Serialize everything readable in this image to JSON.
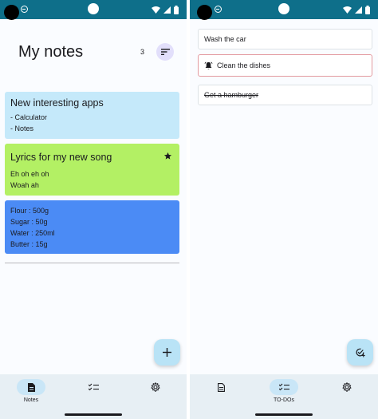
{
  "notes_screen": {
    "title": "My notes",
    "count": "3",
    "notes": [
      {
        "title": "New interesting apps",
        "lines": [
          "- Calculator",
          "- Notes"
        ],
        "color": "#c5e9fa",
        "starred": false
      },
      {
        "title": "Lyrics for my new song",
        "lines": [
          "Eh oh eh oh",
          "Woah ah"
        ],
        "color": "#b3f064",
        "starred": true
      },
      {
        "title": "",
        "lines": [
          "Flour : 500g",
          "Sugar : 50g",
          "Water : 250ml",
          "Butter : 15g"
        ],
        "color": "#4b8bf5",
        "starred": false
      }
    ],
    "nav": [
      {
        "label": "Notes",
        "icon": "note-icon",
        "active": true
      },
      {
        "label": "",
        "icon": "checklist-icon",
        "active": false
      },
      {
        "label": "",
        "icon": "gear-icon",
        "active": false
      }
    ],
    "fab_icon": "plus-icon"
  },
  "todos_screen": {
    "todos": [
      {
        "text": "Wash the car",
        "reminder": false,
        "done": false
      },
      {
        "text": "Clean the dishes",
        "reminder": true,
        "done": false
      },
      {
        "text": "Get a hamburger",
        "reminder": false,
        "done": true
      }
    ],
    "nav": [
      {
        "label": "",
        "icon": "note-icon",
        "active": false
      },
      {
        "label": "TO-DOs",
        "icon": "checklist-icon",
        "active": true
      },
      {
        "label": "",
        "icon": "gear-icon",
        "active": false
      }
    ],
    "fab_icon": "add-task-icon"
  },
  "colors": {
    "status_bar": "#0e6f8a",
    "nav_bar": "#e7eff4",
    "active_pill": "#c9e6f7",
    "fab": "#b9e3f6",
    "sort_button": "#e2dffb",
    "reminder_border": "#e39aa0"
  }
}
